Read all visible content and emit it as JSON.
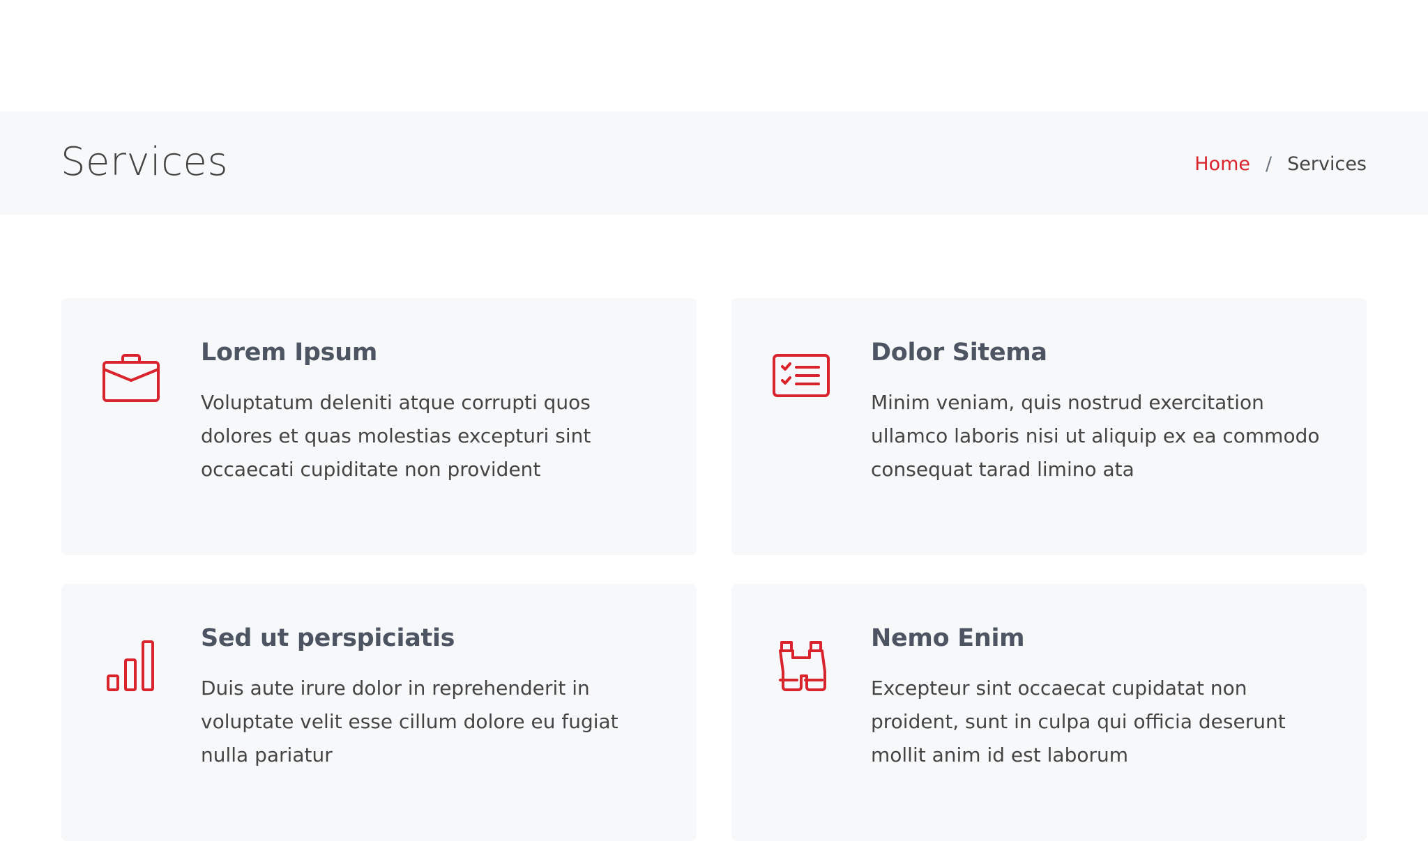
{
  "page": {
    "title": "Services"
  },
  "breadcrumb": {
    "home": "Home",
    "separator": "/",
    "current": "Services"
  },
  "colors": {
    "accent": "#d9232d",
    "card_bg": "#f7f8f9",
    "heading": "#4d5563",
    "text": "#444444"
  },
  "services": [
    {
      "icon": "briefcase-icon",
      "title": "Lorem Ipsum",
      "description": "Voluptatum deleniti atque corrupti quos dolores et quas molestias excepturi sint occaecati cupiditate non provident"
    },
    {
      "icon": "checklist-card-icon",
      "title": "Dolor Sitema",
      "description": "Minim veniam, quis nostrud exercitation ullamco laboris nisi ut aliquip ex ea commodo consequat tarad limino ata"
    },
    {
      "icon": "bar-chart-icon",
      "title": "Sed ut perspiciatis",
      "description": "Duis aute irure dolor in reprehenderit in voluptate velit esse cillum dolore eu fugiat nulla pariatur"
    },
    {
      "icon": "binoculars-icon",
      "title": "Nemo Enim",
      "description": "Excepteur sint occaecat cupidatat non proident, sunt in culpa qui officia deserunt mollit anim id est laborum"
    }
  ]
}
